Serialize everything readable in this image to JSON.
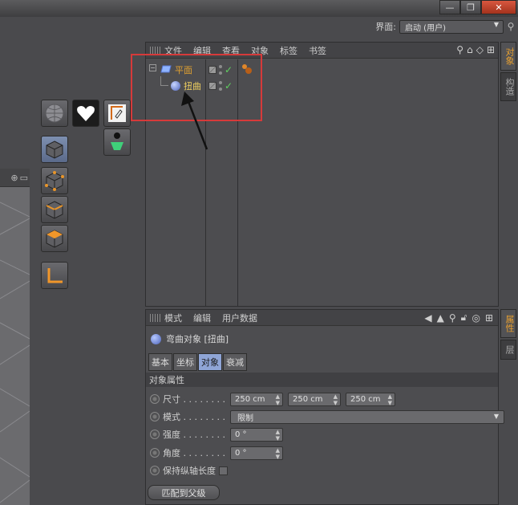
{
  "window": {
    "minimize_symbol": "—",
    "restore_symbol": "❐",
    "close_symbol": "✕"
  },
  "layout": {
    "label": "界面:",
    "value": "启动 (用户)"
  },
  "object_manager": {
    "menu": [
      "文件",
      "编辑",
      "查看",
      "对象",
      "标签",
      "书签"
    ],
    "objects": [
      {
        "name": "平面",
        "level": 0
      },
      {
        "name": "扭曲",
        "level": 1
      }
    ]
  },
  "side_tabs_top": [
    "对象",
    "构造"
  ],
  "side_tabs_bottom": [
    "属性",
    "层"
  ],
  "attributes": {
    "menu": [
      "模式",
      "编辑",
      "用户数据"
    ],
    "object_title": "弯曲对象 [扭曲]",
    "tabs": [
      {
        "label": "基本",
        "active": false
      },
      {
        "label": "坐标",
        "active": false
      },
      {
        "label": "对象",
        "active": true
      },
      {
        "label": "衰减",
        "active": false
      }
    ],
    "section": "对象属性",
    "size_label": "尺寸 . . . . . . . .",
    "size_values": [
      "250 cm",
      "250 cm",
      "250 cm"
    ],
    "mode_label": "模式 . . . . . . . .",
    "mode_value": "限制",
    "strength_label": "强度 . . . . . . . .",
    "strength_value": "0 °",
    "angle_label": "角度 . . . . . . . .",
    "angle_value": "0 °",
    "keep_length_label": "保持纵轴长度",
    "keep_length_checked": false,
    "match_parent_button": "匹配到父级"
  },
  "colors": {
    "parent_object_name": "#e0a030",
    "child_object_name": "#f0d060",
    "annotation_box": "#d63a3a",
    "active_tab": "#8fa5d6"
  }
}
